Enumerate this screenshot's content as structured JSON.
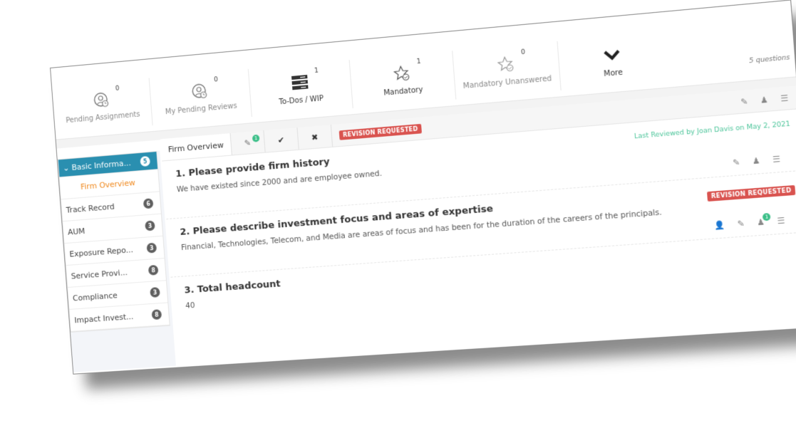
{
  "stats": [
    {
      "label": "Pending Assignments",
      "count": "0",
      "icon": "user-clock-icon",
      "dark": false
    },
    {
      "label": "My Pending Reviews",
      "count": "0",
      "icon": "user-clock-icon",
      "dark": false
    },
    {
      "label": "To-Dos / WIP",
      "count": "1",
      "icon": "server-list-icon",
      "dark": true
    },
    {
      "label": "Mandatory",
      "count": "1",
      "icon": "star-check-icon",
      "dark": true
    },
    {
      "label": "Mandatory Unanswered",
      "count": "0",
      "icon": "star-check-icon",
      "dark": false
    },
    {
      "label": "More",
      "count": "",
      "icon": "chevron-down-icon",
      "dark": true
    }
  ],
  "question_count": "5 questions",
  "sidebar": {
    "items": [
      {
        "label": "Basic Informa...",
        "badge": "5",
        "active": true
      },
      {
        "label": "Firm Overview",
        "badge": "",
        "sub": true
      },
      {
        "label": "Track Record",
        "badge": "6"
      },
      {
        "label": "AUM",
        "badge": "3"
      },
      {
        "label": "Exposure Repo...",
        "badge": "3"
      },
      {
        "label": "Service Provi...",
        "badge": "8"
      },
      {
        "label": "Compliance",
        "badge": "3"
      },
      {
        "label": "Impact Invest...",
        "badge": "8"
      }
    ]
  },
  "tabs": {
    "section": "Firm Overview",
    "edit_badge": "1",
    "approve": "✔",
    "reject": "✖",
    "status": "REVISION REQUESTED"
  },
  "questions": [
    {
      "title": "1. Please provide firm history",
      "answer": "We have existed since 2000 and are employee owned.",
      "meta": "Last Reviewed by Joan Davis on May 2, 2021"
    },
    {
      "title": "2. Please describe investment focus and areas of expertise",
      "answer": "Financial, Technologies, Telecom, and Media are areas of focus and has been for the duration of the careers of the principals.",
      "status": "REVISION REQUESTED",
      "comment_badge": "1"
    },
    {
      "title": "3. Total headcount",
      "answer": "40"
    }
  ]
}
